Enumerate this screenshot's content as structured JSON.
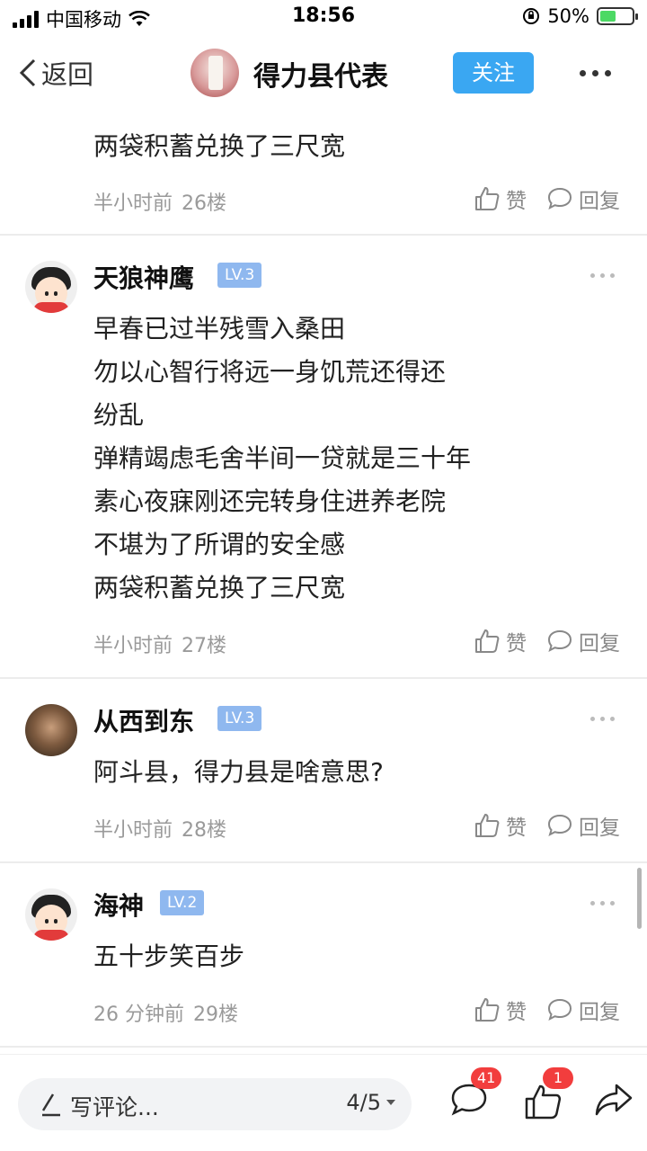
{
  "status_bar": {
    "carrier": "中国移动",
    "time": "18:56",
    "battery_percent": "50%",
    "battery_level": 0.5
  },
  "nav": {
    "back_label": "返回",
    "title": "得力县代表",
    "follow_label": "关注"
  },
  "posts": [
    {
      "lines": [
        "两袋积蓄兑换了三尺宽"
      ],
      "time": "半小时前",
      "floor": "26楼",
      "like_label": "赞",
      "reply_label": "回复"
    },
    {
      "username": "天狼神鹰",
      "level": "LV.3",
      "lines": [
        "早春已过半残雪入桑田",
        "勿以心智行将远一身饥荒还得还",
        "纷乱",
        "弹精竭虑毛舍半间一贷就是三十年",
        "素心夜寐刚还完转身住进养老院",
        "不堪为了所谓的安全感",
        "两袋积蓄兑换了三尺宽"
      ],
      "time": "半小时前",
      "floor": "27楼",
      "like_label": "赞",
      "reply_label": "回复"
    },
    {
      "username": "从西到东",
      "level": "LV.3",
      "lines": [
        "阿斗县，得力县是啥意思?"
      ],
      "time": "半小时前",
      "floor": "28楼",
      "like_label": "赞",
      "reply_label": "回复"
    },
    {
      "username": "海神",
      "level": "LV.2",
      "lines": [
        "五十步笑百步"
      ],
      "time": "26 分钟前",
      "floor": "29楼",
      "like_label": "赞",
      "reply_label": "回复"
    }
  ],
  "bottom": {
    "comment_placeholder": "写评论...",
    "page_indicator": "4/5",
    "comment_count": "41",
    "like_count": "1"
  },
  "colors": {
    "accent": "#3aa7f2",
    "level_badge": "#8fb8ef",
    "notification": "#f23d3d"
  }
}
